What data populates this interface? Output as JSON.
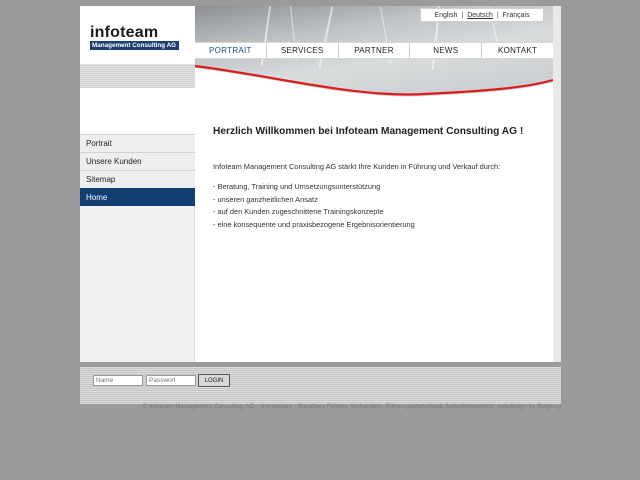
{
  "logo": {
    "word": "infoteam",
    "tagline": "Management Consulting AG"
  },
  "languages": {
    "items": [
      "English",
      "Deutsch",
      "Français"
    ],
    "separator": "|",
    "active": "Deutsch"
  },
  "topnav": {
    "items": [
      "PORTRAIT",
      "SERVICES",
      "PARTNER",
      "NEWS",
      "KONTAKT"
    ],
    "active": "PORTRAIT"
  },
  "sidebar": {
    "items": [
      "Portrait",
      "Unsere Kunden",
      "Sitemap",
      "Home"
    ],
    "active": "Home"
  },
  "content": {
    "title": "Herzlich Willkommen bei Infoteam Management Consulting AG !",
    "intro": "Infoteam Management Consulting AG stärkt Ihre Kunden in Führung und Verkauf durch:",
    "bullets": [
      "- Beratung, Training und Umsetzungsunterstützung",
      "- unseren ganzheitlichen Ansatz",
      "- auf den Kunden zugeschnittene Trainingskonzepte",
      "- eine konsequente und praxisbezogene Ergebnisorientierung"
    ]
  },
  "login": {
    "name_placeholder": "Name",
    "password_placeholder": "Passwort",
    "button_label": "LOGIN"
  },
  "footer": {
    "text": "© Infoteam Management Consulting AG – Impressum - Situatives Führen, Verhandeln, Führungsworkshop& Selbstkompetenz, webdesign by fliegmug"
  },
  "colors": {
    "accent": "#123d73",
    "nav_active": "#1f4a86",
    "hero_red": "#d81d1d",
    "background": "#9b9b9b"
  }
}
